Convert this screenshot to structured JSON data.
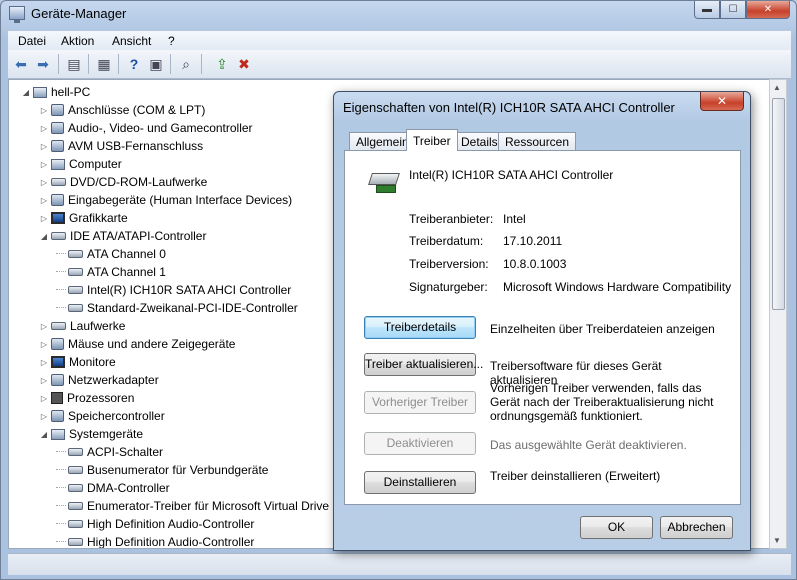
{
  "window": {
    "title": "Geräte-Manager",
    "caption": {
      "minimize": "▬",
      "maximize": "☐",
      "close": "✕"
    }
  },
  "menu": [
    "Datei",
    "Aktion",
    "Ansicht",
    "?"
  ],
  "toolbar_icons": [
    "back-arrow-icon",
    "forward-arrow-icon",
    "show-hide-tree-icon",
    "properties-icon",
    "help-icon",
    "view-icon",
    "scan-hardware-icon",
    "update-driver-icon",
    "uninstall-icon"
  ],
  "tree": {
    "root": "hell-PC",
    "items": [
      {
        "label": "Anschlüsse (COM & LPT)",
        "level": 1,
        "expanded": false
      },
      {
        "label": "Audio-, Video- und Gamecontroller",
        "level": 1,
        "expanded": false
      },
      {
        "label": "AVM USB-Fernanschluss",
        "level": 1,
        "expanded": false
      },
      {
        "label": "Computer",
        "level": 1,
        "expanded": false
      },
      {
        "label": "DVD/CD-ROM-Laufwerke",
        "level": 1,
        "expanded": false
      },
      {
        "label": "Eingabegeräte (Human Interface Devices)",
        "level": 1,
        "expanded": false
      },
      {
        "label": "Grafikkarte",
        "level": 1,
        "expanded": false
      },
      {
        "label": "IDE ATA/ATAPI-Controller",
        "level": 1,
        "expanded": true
      },
      {
        "label": "ATA Channel 0",
        "level": 2
      },
      {
        "label": "ATA Channel 1",
        "level": 2
      },
      {
        "label": "Intel(R) ICH10R SATA AHCI Controller",
        "level": 2
      },
      {
        "label": "Standard-Zweikanal-PCI-IDE-Controller",
        "level": 2
      },
      {
        "label": "Laufwerke",
        "level": 1,
        "expanded": false
      },
      {
        "label": "Mäuse und andere Zeigegeräte",
        "level": 1,
        "expanded": false
      },
      {
        "label": "Monitore",
        "level": 1,
        "expanded": false
      },
      {
        "label": "Netzwerkadapter",
        "level": 1,
        "expanded": false
      },
      {
        "label": "Prozessoren",
        "level": 1,
        "expanded": false
      },
      {
        "label": "Speichercontroller",
        "level": 1,
        "expanded": false
      },
      {
        "label": "Systemgeräte",
        "level": 1,
        "expanded": true
      },
      {
        "label": "ACPI-Schalter",
        "level": 2
      },
      {
        "label": "Busenumerator für Verbundgeräte",
        "level": 2
      },
      {
        "label": "DMA-Controller",
        "level": 2
      },
      {
        "label": "Enumerator-Treiber für Microsoft Virtual Drive",
        "level": 2
      },
      {
        "label": "High Definition Audio-Controller",
        "level": 2
      },
      {
        "label": "High Definition Audio-Controller",
        "level": 2
      }
    ]
  },
  "dialog": {
    "title": "Eigenschaften von Intel(R) ICH10R SATA AHCI Controller",
    "close": "✕",
    "tabs": [
      "Allgemein",
      "Treiber",
      "Details",
      "Ressourcen"
    ],
    "active_tab": "Treiber",
    "device_name": "Intel(R) ICH10R SATA AHCI Controller",
    "fields": [
      {
        "label": "Treiberanbieter:",
        "value": "Intel"
      },
      {
        "label": "Treiberdatum:",
        "value": "17.10.2011"
      },
      {
        "label": "Treiberversion:",
        "value": "10.8.0.1003"
      },
      {
        "label": "Signaturgeber:",
        "value": "Microsoft Windows Hardware Compatibility"
      }
    ],
    "actions": [
      {
        "button": "Treiberdetails",
        "desc": "Einzelheiten über Treiberdateien anzeigen",
        "enabled": true
      },
      {
        "button": "Treiber aktualisieren...",
        "desc": "Treibersoftware für dieses Gerät aktualisieren",
        "enabled": true
      },
      {
        "button": "Vorheriger Treiber",
        "desc": "Vorherigen Treiber verwenden, falls das Gerät nach der Treiberaktualisierung nicht ordnungsgemäß funktioniert.",
        "enabled": false
      },
      {
        "button": "Deaktivieren",
        "desc": "Das ausgewählte Gerät deaktivieren.",
        "enabled": false
      },
      {
        "button": "Deinstallieren",
        "desc": "Treiber deinstallieren (Erweitert)",
        "enabled": true
      }
    ],
    "ok": "OK",
    "cancel": "Abbrechen"
  }
}
